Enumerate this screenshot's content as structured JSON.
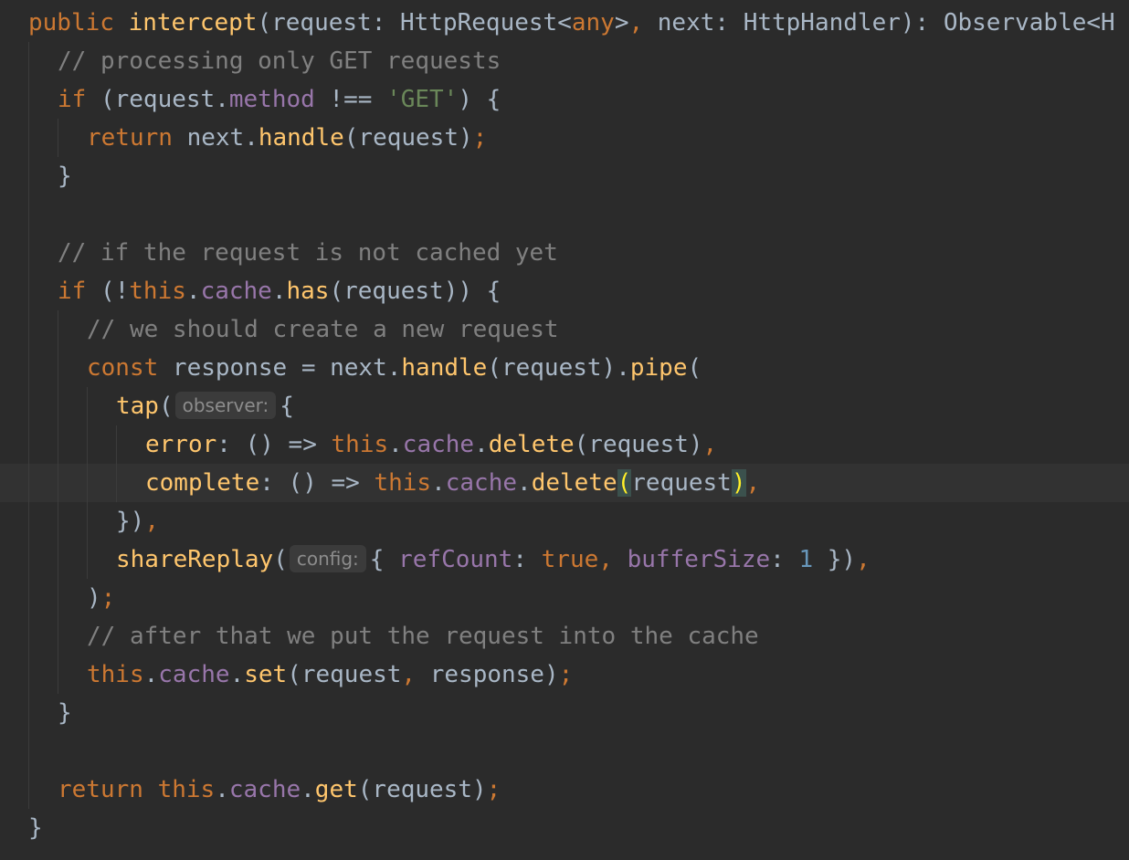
{
  "editor": {
    "theme_colors": {
      "background": "#2b2b2b",
      "current_line": "#323232",
      "default": "#a9b7c6",
      "keyword": "#cc7832",
      "function": "#ffc66d",
      "property": "#9876aa",
      "string": "#6a8759",
      "number": "#6897bb",
      "comment": "#808080",
      "brace_match": "#ffef28"
    },
    "current_line_index": 12,
    "code": {
      "l0": {
        "t0": "public",
        "t1": " ",
        "t2": "intercept",
        "t3": "(request: HttpRequest<",
        "t4": "any",
        "t5": ">",
        "t6": ",",
        "t7": " next: HttpHandler): Observable<H"
      },
      "l1": {
        "t0": "// processing only GET requests"
      },
      "l2": {
        "t0": "if",
        "t1": " (request.",
        "t2": "method",
        "t3": " !== ",
        "t4": "'GET'",
        "t5": ") {"
      },
      "l3": {
        "t0": "return",
        "t1": " next.",
        "t2": "handle",
        "t3": "(request)",
        "t4": ";"
      },
      "l4": {
        "t0": "}"
      },
      "l6": {
        "t0": "// if the request is not cached yet"
      },
      "l7": {
        "t0": "if",
        "t1": " (!",
        "t2": "this",
        "t3": ".",
        "t4": "cache",
        "t5": ".",
        "t6": "has",
        "t7": "(request)) {"
      },
      "l8": {
        "t0": "// we should create a new request"
      },
      "l9": {
        "t0": "const",
        "t1": " response = next.",
        "t2": "handle",
        "t3": "(request).",
        "t4": "pipe",
        "t5": "("
      },
      "l10": {
        "t0": "tap",
        "t1": "(",
        "hint": "observer:",
        "t2": "{"
      },
      "l11": {
        "t0": "error",
        "t1": ": () => ",
        "t2": "this",
        "t3": ".",
        "t4": "cache",
        "t5": ".",
        "t6": "delete",
        "t7": "(request)",
        "t8": ","
      },
      "l12": {
        "t0": "complete",
        "t1": ": () => ",
        "t2": "this",
        "t3": ".",
        "t4": "cache",
        "t5": ".",
        "t6": "delete",
        "t7": "(",
        "t8": "request",
        "t9": ")",
        "t10": ","
      },
      "l13": {
        "t0": "})",
        "t1": ","
      },
      "l14": {
        "t0": "shareReplay",
        "t1": "(",
        "hint": "config:",
        "t2": "{ ",
        "t3": "refCount",
        "t4": ": ",
        "t5": "true",
        "t6": ", ",
        "t7": "bufferSize",
        "t8": ": ",
        "t9": "1",
        "t10": " })",
        "t11": ","
      },
      "l15": {
        "t0": ")",
        "t1": ";"
      },
      "l16": {
        "t0": "// after that we put the request into the cache"
      },
      "l17": {
        "t0": "this",
        "t1": ".",
        "t2": "cache",
        "t3": ".",
        "t4": "set",
        "t5": "(request",
        "t6": ",",
        "t7": " response)",
        "t8": ";"
      },
      "l18": {
        "t0": "}"
      },
      "l20": {
        "t0": "return",
        "t1": " ",
        "t2": "this",
        "t3": ".",
        "t4": "cache",
        "t5": ".",
        "t6": "get",
        "t7": "(request)",
        "t8": ";"
      },
      "l21": {
        "t0": "}"
      }
    }
  }
}
